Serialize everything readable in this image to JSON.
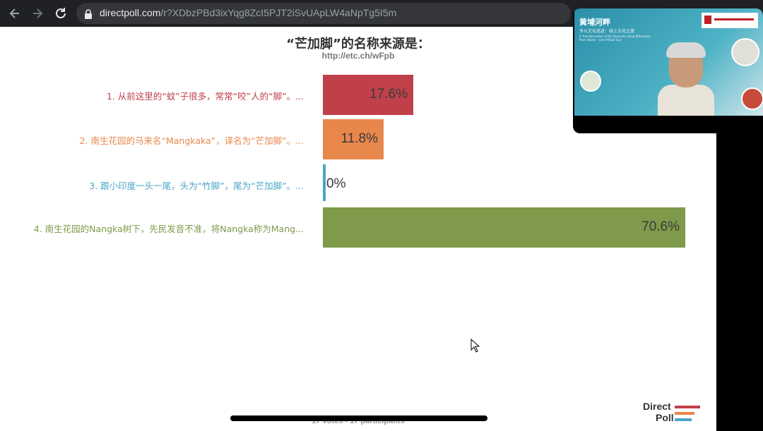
{
  "browser": {
    "url_host": "directpoll.com",
    "url_path": "/r?XDbzPBd3ixYqg8ZcI5PJT2iSvUApLW4aNpTg5I5m",
    "icons": [
      "back-arrow-icon",
      "forward-arrow-icon",
      "reload-icon",
      "lock-icon"
    ]
  },
  "poll": {
    "title": "“芒加脚”的名称来源是：",
    "link": "http://etc.ch/wFpb",
    "options": [
      {
        "label": "1. 从前这里的“蚊”子很多，常常“咬”人的“脚”。...",
        "percent_text": "17.6%",
        "percent": 17.6,
        "color": "#c0404a"
      },
      {
        "label": "2. 南生花园的马来名“Mangkaka”，译名为“芒加脚”。...",
        "percent_text": "11.8%",
        "percent": 11.8,
        "color": "#e8874c"
      },
      {
        "label": "3. 跟小印度一头一尾，头为“竹脚”，尾为“芒加脚”。...",
        "percent_text": "0%",
        "percent": 0,
        "color": "#4aa6c8"
      },
      {
        "label": "4. 南生花园的Nangka树下，先民发音不准，将Nangka称为Mang...",
        "percent_text": "70.6%",
        "percent": 70.6,
        "color": "#7e9a4a"
      }
    ],
    "footer": "17 votes - 17 participants"
  },
  "brand": {
    "line1": "Direct",
    "line2": "Poll",
    "stripe_colors": [
      "#c0404a",
      "#e8874c",
      "#4aa6c8"
    ]
  },
  "video": {
    "headline": "黄埔河畔",
    "subline": "多元文化巡迹：线上文化之旅",
    "english": "A Transformation of the Diversity along Whampoa River Banks · Live Virtual Tour",
    "accent": "#2a8fa8"
  }
}
